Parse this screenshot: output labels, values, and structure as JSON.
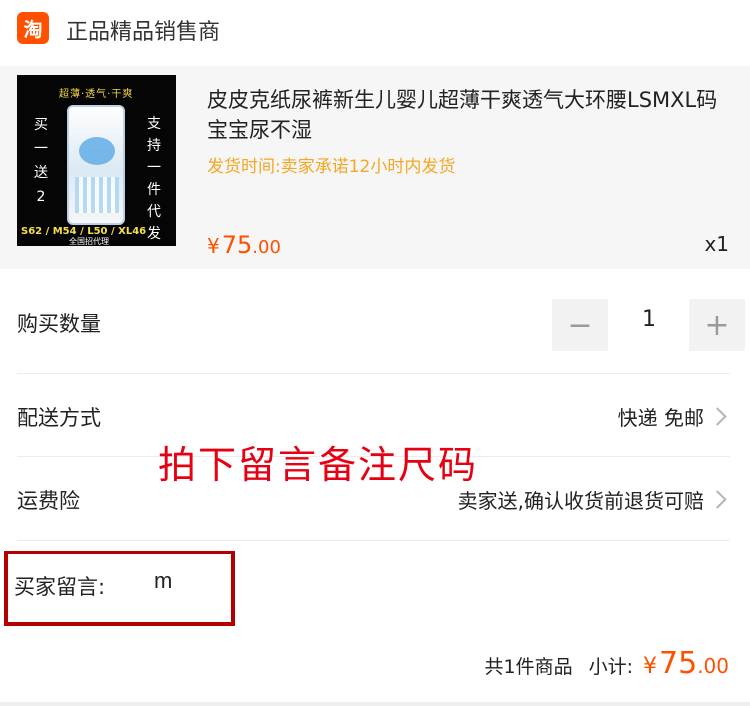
{
  "shop": {
    "logo_text": "淘",
    "name": "正品精品销售商"
  },
  "product": {
    "image": {
      "banner": "超薄·透气·干爽",
      "left_text": "买一送2",
      "right_text": "支持一件代发",
      "sizes": "S62 / M54 / L50 / XL46",
      "agent": "全国招代理"
    },
    "title": "皮皮克纸尿裤新生儿婴儿超薄干爽透气大环腰LSMXL码宝宝尿不湿",
    "shipping_note": "发货时间:卖家承诺12小时内发货",
    "price_currency": "¥",
    "price_int": "75",
    "price_dec": ".00",
    "quantity_label": "x1"
  },
  "quantity": {
    "label": "购买数量",
    "minus": "−",
    "value": "1",
    "plus": "+"
  },
  "delivery": {
    "label": "配送方式",
    "value": "快递 免邮"
  },
  "annotation": "拍下留言备注尺码",
  "insurance": {
    "label": "运费险",
    "value": "卖家送,确认收货前退货可赔"
  },
  "message": {
    "label": "买家留言:",
    "value": "m"
  },
  "summary": {
    "count_text": "共1件商品",
    "subtotal_label": "小计:",
    "currency": "¥",
    "amount_int": "75",
    "amount_dec": ".00"
  },
  "colors": {
    "accent": "#ff5000",
    "shipping": "#f5a623",
    "annotation": "#e60012",
    "highlight_box": "#b40000"
  }
}
